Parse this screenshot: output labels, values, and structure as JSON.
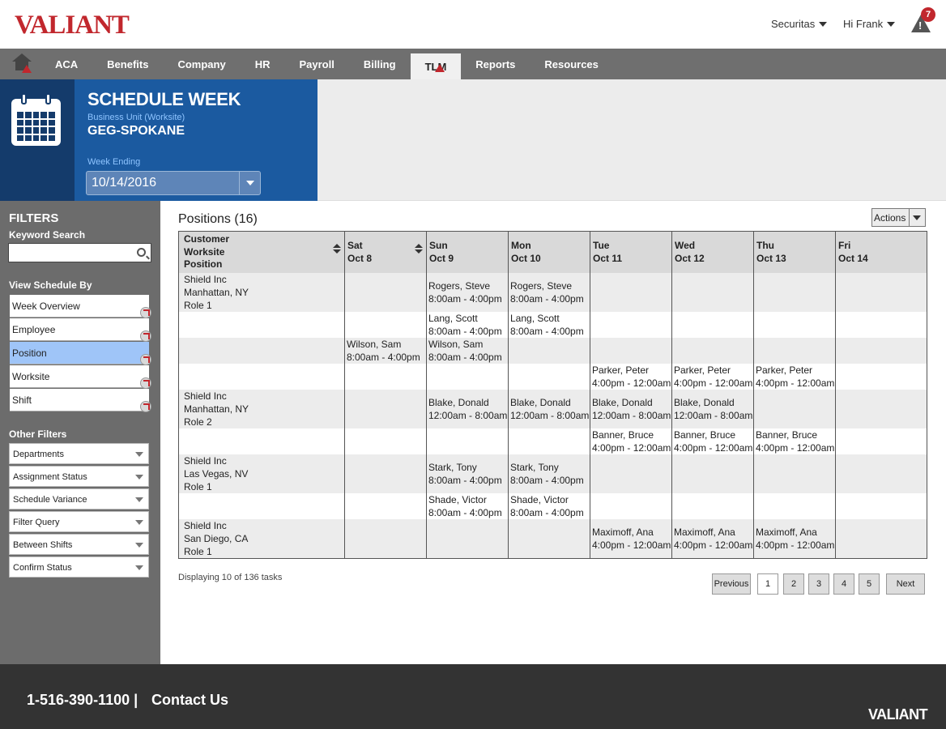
{
  "header": {
    "logo": "VALIANT",
    "company_menu": "Securitas",
    "user_menu": "Hi Frank",
    "alert_count": "7"
  },
  "nav": {
    "items": [
      "ACA",
      "Benefits",
      "Company",
      "HR",
      "Payroll",
      "Billing",
      "TLM",
      "Reports",
      "Resources"
    ],
    "active": "TLM"
  },
  "schedule": {
    "title": "SCHEDULE WEEK",
    "business_unit_label": "Business Unit (Worksite)",
    "business_unit_value": "GEG-SPOKANE",
    "week_ending_label": "Week Ending",
    "week_ending_value": "10/14/2016"
  },
  "sidebar": {
    "filters_heading": "FILTERS",
    "keyword_label": "Keyword Search",
    "keyword_value": "",
    "view_by_heading": "View Schedule By",
    "view_by_items": [
      "Week Overview",
      "Employee",
      "Position",
      "Worksite",
      "Shift"
    ],
    "view_by_selected": "Position",
    "other_filters_heading": "Other Filters",
    "other_filters": [
      "Departments",
      "Assignment Status",
      "Schedule Variance",
      "Filter Query",
      "Between Shifts",
      "Confirm Status"
    ]
  },
  "main": {
    "positions_title": "Positions (16)",
    "actions_label": "Actions",
    "columns": [
      {
        "line1": "Customer",
        "line2": "Worksite",
        "line3": "Position"
      },
      {
        "line1": "Sat",
        "line2": "Oct 8"
      },
      {
        "line1": "Sun",
        "line2": "Oct 9"
      },
      {
        "line1": "Mon",
        "line2": "Oct 10"
      },
      {
        "line1": "Tue",
        "line2": "Oct 11"
      },
      {
        "line1": "Wed",
        "line2": "Oct 12"
      },
      {
        "line1": "Thu",
        "line2": "Oct 13"
      },
      {
        "line1": "Fri",
        "line2": "Oct 14"
      }
    ],
    "rows": [
      {
        "shade": true,
        "position": [
          "Shield Inc",
          "Manhattan, NY",
          "Role 1"
        ],
        "cells": [
          null,
          [
            "Rogers, Steve",
            "8:00am - 4:00pm"
          ],
          [
            "Rogers, Steve",
            "8:00am - 4:00pm"
          ],
          null,
          null,
          null,
          null
        ]
      },
      {
        "shade": false,
        "position": [],
        "cells": [
          null,
          [
            "Lang, Scott",
            "8:00am - 4:00pm"
          ],
          [
            "Lang, Scott",
            "8:00am - 4:00pm"
          ],
          null,
          null,
          null,
          null
        ]
      },
      {
        "shade": true,
        "position": [],
        "cells": [
          [
            "Wilson, Sam",
            "8:00am - 4:00pm"
          ],
          [
            "Wilson, Sam",
            "8:00am - 4:00pm"
          ],
          null,
          null,
          null,
          null,
          null
        ]
      },
      {
        "shade": false,
        "position": [],
        "cells": [
          null,
          null,
          null,
          [
            "Parker, Peter",
            "4:00pm - 12:00am"
          ],
          [
            "Parker, Peter",
            "4:00pm - 12:00am"
          ],
          [
            "Parker, Peter",
            "4:00pm - 12:00am"
          ],
          null
        ]
      },
      {
        "shade": true,
        "position": [
          "Shield Inc",
          "Manhattan, NY",
          "Role 2"
        ],
        "cells": [
          null,
          [
            "Blake, Donald",
            "12:00am - 8:00am"
          ],
          [
            "Blake, Donald",
            "12:00am - 8:00am"
          ],
          [
            "Blake, Donald",
            "12:00am - 8:00am"
          ],
          [
            "Blake, Donald",
            "12:00am - 8:00am"
          ],
          null,
          null
        ]
      },
      {
        "shade": false,
        "position": [],
        "cells": [
          null,
          null,
          null,
          [
            "Banner, Bruce",
            "4:00pm - 12:00am"
          ],
          [
            "Banner, Bruce",
            "4:00pm - 12:00am"
          ],
          [
            "Banner, Bruce",
            "4:00pm - 12:00am"
          ],
          null
        ]
      },
      {
        "shade": true,
        "position": [
          "Shield Inc",
          "Las Vegas, NV",
          "Role 1"
        ],
        "cells": [
          null,
          [
            "Stark, Tony",
            "8:00am - 4:00pm"
          ],
          [
            "Stark, Tony",
            "8:00am - 4:00pm"
          ],
          null,
          null,
          null,
          null
        ]
      },
      {
        "shade": false,
        "position": [],
        "cells": [
          null,
          [
            "Shade, Victor",
            "8:00am - 4:00pm"
          ],
          [
            "Shade, Victor",
            "8:00am - 4:00pm"
          ],
          null,
          null,
          null,
          null
        ]
      },
      {
        "shade": true,
        "position": [
          "Shield Inc",
          "San Diego, CA",
          "Role 1"
        ],
        "cells": [
          null,
          null,
          null,
          [
            "Maximoff, Ana",
            "4:00pm - 12:00am"
          ],
          [
            "Maximoff, Ana",
            "4:00pm - 12:00am"
          ],
          [
            "Maximoff, Ana",
            "4:00pm - 12:00am"
          ],
          null
        ]
      }
    ],
    "displaying_text": "Displaying 10 of 136 tasks",
    "pagination": {
      "previous": "Previous",
      "pages": [
        "1",
        "2",
        "3",
        "4",
        "5"
      ],
      "current": "1",
      "next": "Next"
    }
  },
  "footer": {
    "phone": "1-516-390-1100 |",
    "contact": "Contact Us",
    "logo": "VALIANT"
  },
  "colors": {
    "brand_red": "#c1272d",
    "nav_grey": "#6f6f6f",
    "header_blue": "#1b5aa0",
    "header_dark_blue": "#143b6b",
    "selected_filter": "#9fc5f8",
    "footer": "#333333"
  }
}
